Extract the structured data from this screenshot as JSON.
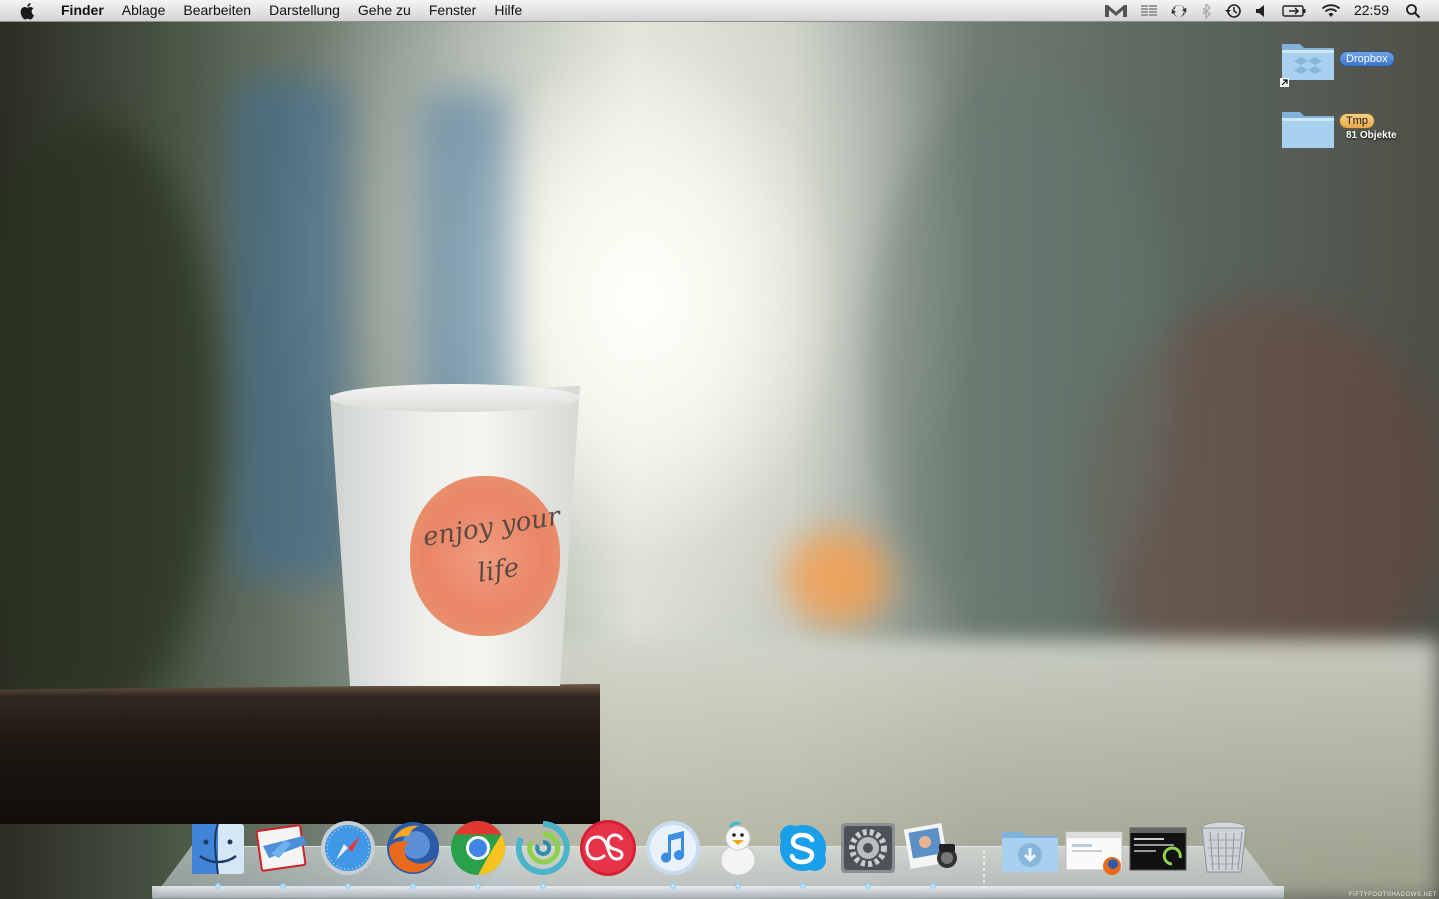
{
  "menubar": {
    "app_name": "Finder",
    "menus": [
      "Ablage",
      "Bearbeiten",
      "Darstellung",
      "Gehe zu",
      "Fenster",
      "Hilfe"
    ],
    "status_icons": [
      "gmail-icon",
      "menu-meter-icon",
      "sync-icon",
      "bluetooth-icon",
      "time-machine-icon",
      "volume-icon",
      "battery-icon",
      "wifi-icon"
    ],
    "clock": "22:59"
  },
  "desktop": {
    "icons": [
      {
        "name": "Dropbox",
        "label_color": "blue",
        "is_alias": true
      },
      {
        "name": "Tmp",
        "label_color": "orange",
        "info": "81 Objekte"
      }
    ]
  },
  "wallpaper": {
    "cup_text": "enjoy your life"
  },
  "dock": {
    "apps": [
      "Finder",
      "Mail",
      "Safari",
      "Firefox",
      "Google Chrome",
      "Coherence",
      "Last.fm",
      "iTunes",
      "Adium",
      "Skype",
      "Systemeinstellungen",
      "iPhoto"
    ],
    "running": [
      "Finder",
      "Mail",
      "Safari",
      "Firefox",
      "Google Chrome",
      "Coherence",
      "iTunes",
      "Adium",
      "Skype",
      "Systemeinstellungen",
      "iPhoto"
    ],
    "stacks": [
      "Downloads",
      "Firefox Window",
      "Terminal Window",
      "Papierkorb"
    ]
  },
  "watermark": "FIFTYFOOTSHADOWS.NET",
  "colors": {
    "menubar_top": "#f4f4f4",
    "menubar_bottom": "#d3d3d3",
    "label_blue": "#3a73cf",
    "label_orange": "#e9a948"
  }
}
